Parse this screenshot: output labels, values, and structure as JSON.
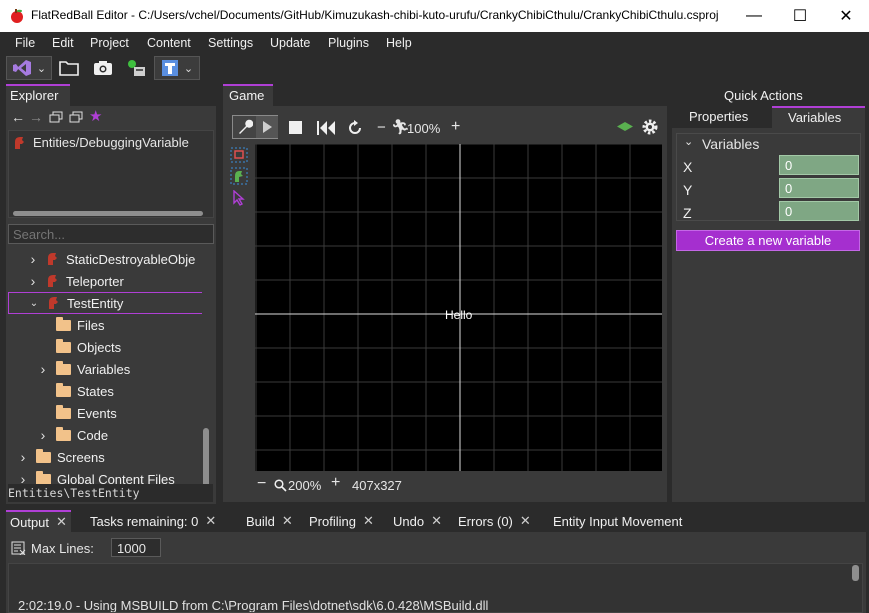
{
  "window": {
    "title": "FlatRedBall Editor - C:/Users/vchel/Documents/GitHub/Kimuzukash-chibi-kuto-urufu/CrankyChibiCthulu/CrankyChibiCthulu.csproj",
    "minimize": "—",
    "maximize": "☐",
    "close": "✕"
  },
  "menu": [
    "File",
    "Edit",
    "Project",
    "Content",
    "Settings",
    "Update",
    "Plugins",
    "Help"
  ],
  "explorer": {
    "tab": "Explorer",
    "recent": "Entities/DebuggingVariable",
    "search_placeholder": "Search...",
    "tree": [
      {
        "label": "StaticDestroyableObje",
        "indent": 0,
        "icon": "entity",
        "expand": "›"
      },
      {
        "label": "Teleporter",
        "indent": 0,
        "icon": "entity",
        "expand": "›"
      },
      {
        "label": "TestEntity",
        "indent": 0,
        "icon": "entity",
        "expand": "⌄",
        "selected": true
      },
      {
        "label": "Files",
        "indent": 1,
        "icon": "folder",
        "expand": ""
      },
      {
        "label": "Objects",
        "indent": 1,
        "icon": "folder",
        "expand": ""
      },
      {
        "label": "Variables",
        "indent": 1,
        "icon": "folder",
        "expand": "›"
      },
      {
        "label": "States",
        "indent": 1,
        "icon": "folder",
        "expand": ""
      },
      {
        "label": "Events",
        "indent": 1,
        "icon": "folder",
        "expand": ""
      },
      {
        "label": "Code",
        "indent": 1,
        "icon": "folder",
        "expand": "›"
      },
      {
        "label": "Screens",
        "indent": -1,
        "icon": "folder",
        "expand": "›"
      },
      {
        "label": "Global Content Files",
        "indent": -1,
        "icon": "folder",
        "expand": "›"
      }
    ],
    "status_path": "Entities\\TestEntity"
  },
  "game": {
    "tab": "Game",
    "zoom_top": "100%",
    "canvas_text": "Hello",
    "zoom_bottom": "200%",
    "resolution": "407x327",
    "minus": "−",
    "plus": "+"
  },
  "quick_actions": {
    "title": "Quick Actions",
    "tab_properties": "Properties",
    "tab_variables": "Variables",
    "group": "Variables",
    "vars": [
      {
        "name": "X",
        "value": "0"
      },
      {
        "name": "Y",
        "value": "0"
      },
      {
        "name": "Z",
        "value": "0"
      }
    ],
    "create_button": "Create a new variable"
  },
  "bottom": {
    "tabs": [
      "Output",
      "Tasks remaining: 0",
      "Build",
      "Profiling",
      "Undo",
      "Errors (0)",
      "Entity Input Movement"
    ],
    "max_lines_label": "Max Lines:",
    "max_lines_value": "1000",
    "log_line": "2:02:19.0 - Using MSBUILD from C:\\Program Files\\dotnet\\sdk\\6.0.428\\MSBuild.dll"
  },
  "colors": {
    "accent": "#b03fd6",
    "panel": "#3a3a3a",
    "background": "#2b2b2b",
    "value_field": "#7fa784",
    "entity_red": "#c0392b"
  }
}
